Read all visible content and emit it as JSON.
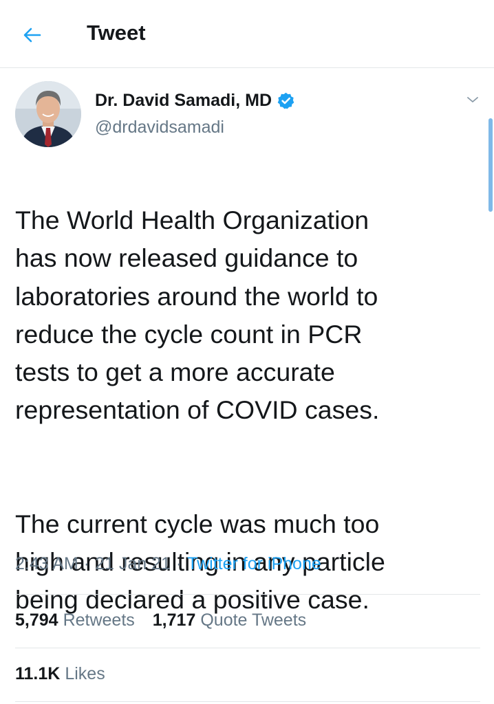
{
  "header": {
    "title": "Tweet",
    "back_icon": "arrow-left-icon",
    "accent_color": "#1da1f2"
  },
  "author": {
    "display_name": "Dr. David Samadi, MD",
    "handle": "@drdavidsamadi",
    "verified": true,
    "verified_icon": "verified-badge-icon"
  },
  "tweet": {
    "paragraphs": [
      "The World Health Organization\nhas now released guidance to\nlaboratories around the world to\nreduce the cycle count in PCR\ntests to get a more accurate\nrepresentation of COVID cases.",
      "The current cycle was much too\nhigh and resulting in any particle\nbeing declared a positive case."
    ]
  },
  "meta": {
    "time": "2:43 AM",
    "date": "21 Jan 21",
    "separator": "·",
    "source": "Twitter for iPhone"
  },
  "stats": {
    "retweets_count": "5,794",
    "retweets_label": "Retweets",
    "quotes_count": "1,717",
    "quotes_label": "Quote Tweets",
    "likes_count": "11.1K",
    "likes_label": "Likes"
  },
  "colors": {
    "text": "#14171a",
    "secondary": "#657786",
    "link": "#1da1f2",
    "divider": "#e3e6e8"
  }
}
